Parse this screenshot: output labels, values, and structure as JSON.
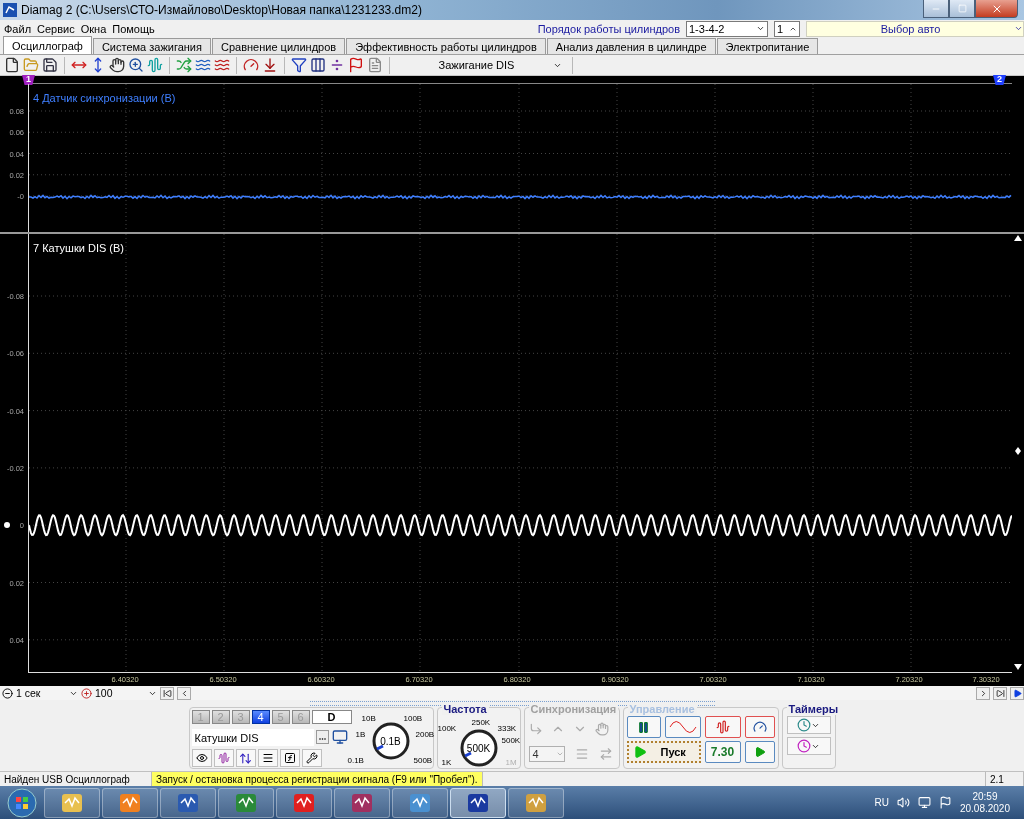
{
  "window": {
    "title": "Diamag 2 (C:\\Users\\СТО-Измайлово\\Desktop\\Новая папка\\1231233.dm2)"
  },
  "menu": [
    "Файл",
    "Сервис",
    "Окна",
    "Помощь"
  ],
  "cylinder_order": {
    "label": "Порядок работы цилиндров",
    "value": "1-3-4-2",
    "spin": "1"
  },
  "car_select": {
    "value": "Выбор авто"
  },
  "tabs": [
    {
      "label": "Осциллограф",
      "selected": true
    },
    {
      "label": "Система зажигания",
      "selected": false
    },
    {
      "label": "Сравнение цилиндров",
      "selected": false
    },
    {
      "label": "Эффективность работы цилиндров",
      "selected": false
    },
    {
      "label": "Анализ давления в цилиндре",
      "selected": false
    },
    {
      "label": "Электропитание",
      "selected": false
    }
  ],
  "toolbar": {
    "mode_select": "Зажигание DIS"
  },
  "cursors": [
    {
      "label": "1",
      "color": "#a020c0"
    },
    {
      "label": "2",
      "color": "#2040ff"
    }
  ],
  "channels": [
    {
      "title": "4 Датчик синхронизации (В)",
      "color": "#3f7fff",
      "yticks": [
        "0.08",
        "0.06",
        "0.04",
        "0.02",
        "-0"
      ]
    },
    {
      "title": "7 Катушки DIS (В)",
      "color": "#ffffff",
      "yticks": [
        "-0.08",
        "-0.06",
        "-0.04",
        "-0.02",
        "0",
        "0.02",
        "0.04"
      ]
    }
  ],
  "x_axis": [
    "6.40320",
    "6.50320",
    "6.60320",
    "6.70320",
    "6.80320",
    "6.90320",
    "7.00320",
    "7.10320",
    "7.20320",
    "7.30320"
  ],
  "timebase": {
    "scale": "1 сек",
    "zoom": "100"
  },
  "channel_panel": {
    "channel_tabs": [
      {
        "label": "1",
        "kind": "analog",
        "selected": false
      },
      {
        "label": "2",
        "kind": "analog",
        "selected": false
      },
      {
        "label": "3",
        "kind": "analog",
        "selected": false
      },
      {
        "label": "4",
        "kind": "analog",
        "selected": true
      },
      {
        "label": "5",
        "kind": "analog",
        "selected": false
      },
      {
        "label": "6",
        "kind": "analog",
        "selected": false
      },
      {
        "label": "D",
        "kind": "digital",
        "selected": false
      }
    ],
    "name": "Катушки DIS",
    "knob": {
      "labels": [
        {
          "text": "10В",
          "disabled": false
        },
        {
          "text": "100В",
          "disabled": false
        },
        {
          "text": "1В",
          "disabled": false
        },
        {
          "text": "200В",
          "disabled": false
        },
        {
          "text": "0.1В",
          "disabled": false
        },
        {
          "text": "500В",
          "disabled": false
        }
      ],
      "value": "0.1В"
    }
  },
  "frequency": {
    "title": "Частота",
    "labels": [
      {
        "text": "250K",
        "disabled": false
      },
      {
        "text": "100K",
        "disabled": false
      },
      {
        "text": "333K",
        "disabled": false
      },
      {
        "text": "500K",
        "disabled": false
      },
      {
        "text": "1K",
        "disabled": false
      },
      {
        "text": "1M",
        "disabled": true
      }
    ],
    "value": "500K"
  },
  "sync": {
    "title": "Синхронизация",
    "channel": "4"
  },
  "control": {
    "title": "Управление",
    "start": "Пуск",
    "time": "7.30"
  },
  "timers": {
    "title": "Таймеры"
  },
  "status_bar": {
    "device": "Найден USB Осциллограф",
    "hint": "Запуск / остановка процесса регистрации сигнала (F9 или \"Пробел\").",
    "version": "2.1"
  },
  "taskbar": {
    "language": "RU",
    "time": "20:59",
    "date": "20.08.2020"
  }
}
